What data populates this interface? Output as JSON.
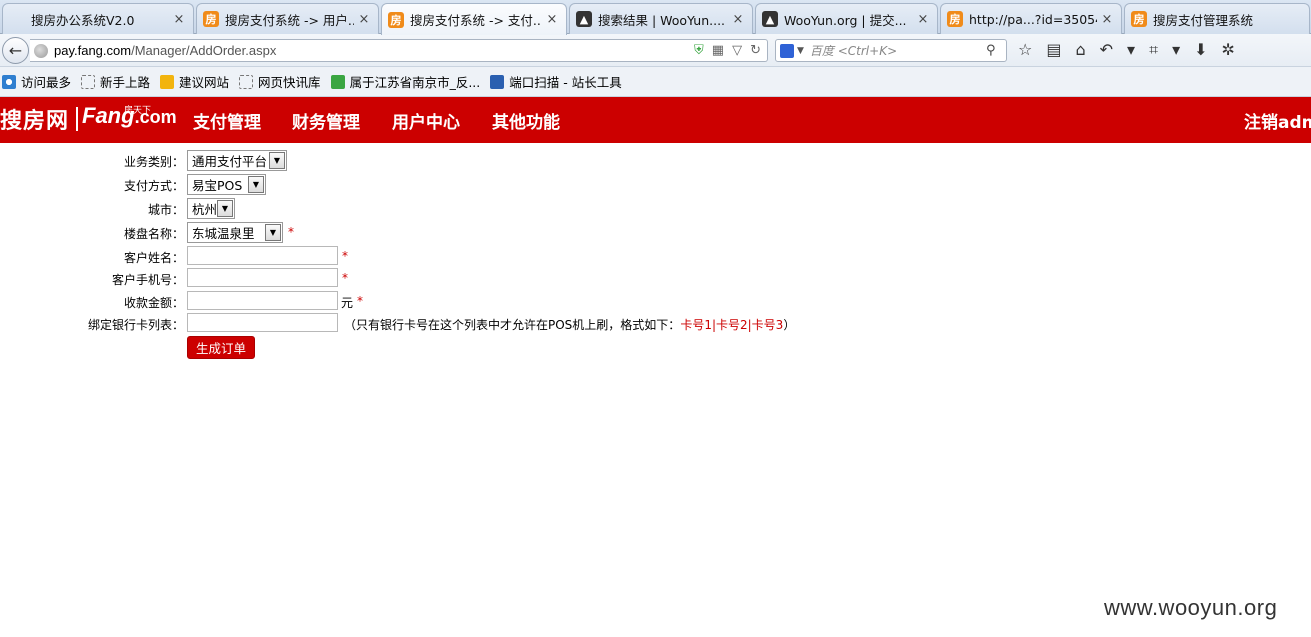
{
  "tabs": [
    {
      "title": "搜房办公系统V2.0",
      "icon": "blank",
      "active": false
    },
    {
      "title": "搜房支付系统 -> 用户...",
      "icon": "fang",
      "active": false
    },
    {
      "title": "搜房支付系统 -> 支付...",
      "icon": "fang",
      "active": true
    },
    {
      "title": "搜索结果 | WooYun....",
      "icon": "wooyun",
      "active": false
    },
    {
      "title": "WooYun.org | 提交...",
      "icon": "wooyun",
      "active": false
    },
    {
      "title": "http://pa...?id=35054",
      "icon": "fang",
      "active": false
    },
    {
      "title": "搜房支付管理系统",
      "icon": "fang",
      "active": false
    }
  ],
  "tab_close": "×",
  "tab_icon_glyph": "房",
  "browser": {
    "url_host": "pay.fang.com",
    "url_path": "/Manager/AddOrder.aspx",
    "search_placeholder": "百度 <Ctrl+K>"
  },
  "bookmarks": [
    {
      "label": "访问最多",
      "icon": "ie"
    },
    {
      "label": "新手上路",
      "icon": "blank"
    },
    {
      "label": "建议网站",
      "icon": "bing"
    },
    {
      "label": "网页快讯库",
      "icon": "blank"
    },
    {
      "label": "属于江苏省南京市_反...",
      "icon": "green"
    },
    {
      "label": "端口扫描 - 站长工具",
      "icon": "blue"
    }
  ],
  "site": {
    "logo_cn": "搜房网",
    "logo_en": "Fang",
    "logo_en_suffix": ".com",
    "logo_tag": "房天下",
    "nav": [
      "支付管理",
      "财务管理",
      "用户中心",
      "其他功能"
    ],
    "logout": "注销adm"
  },
  "form": {
    "business_type_label": "业务类别：",
    "business_type_value": "通用支付平台",
    "pay_method_label": "支付方式：",
    "pay_method_value": "易宝POS",
    "city_label": "城市：",
    "city_value": "杭州",
    "building_label": "楼盘名称：",
    "building_value": "东城温泉里",
    "customer_name_label": "客户姓名：",
    "customer_name_value": "",
    "customer_phone_label": "客户手机号：",
    "customer_phone_value": "",
    "amount_label": "收款金额：",
    "amount_value": "",
    "amount_unit": "元",
    "bank_cards_label": "绑定银行卡列表：",
    "bank_cards_value": "",
    "bank_cards_hint_prefix": "（只有银行卡号在这个列表中才允许在POS机上刷，格式如下：",
    "bank_cards_hint_example": "卡号1|卡号2|卡号3",
    "bank_cards_hint_suffix": "）",
    "required_mark": "*",
    "submit_label": "生成订单"
  },
  "watermark": "www.wooyun.org",
  "colors": {
    "brand_red": "#cc0000",
    "tab_icon_orange": "#f08b1a"
  }
}
